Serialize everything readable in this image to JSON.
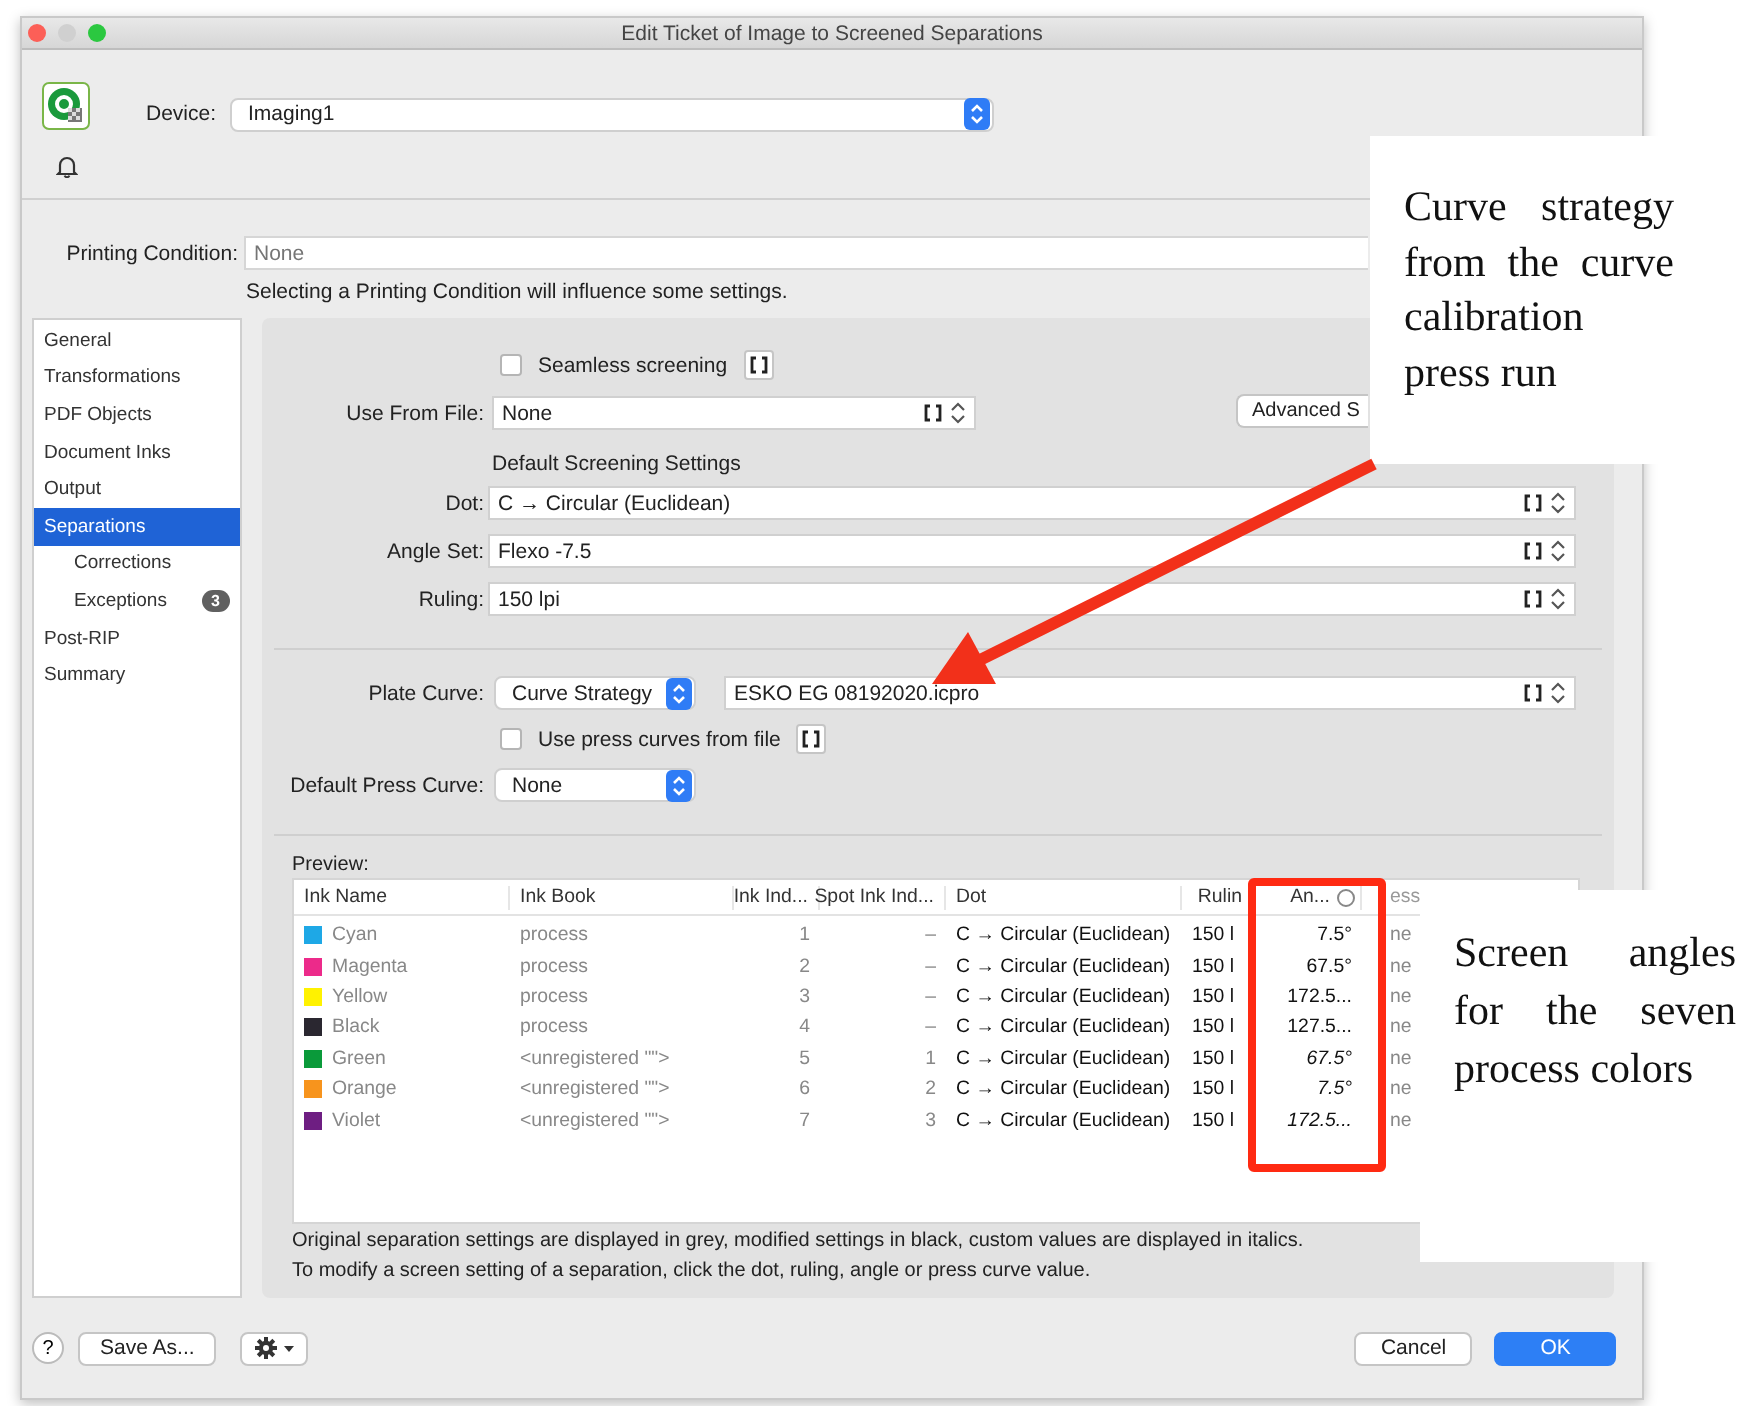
{
  "window": {
    "title": "Edit Ticket of Image to Screened Separations"
  },
  "device": {
    "label": "Device:",
    "value": "Imaging1"
  },
  "printing_condition": {
    "label": "Printing Condition:",
    "placeholder": "None",
    "note": "Selecting a Printing Condition will influence some settings."
  },
  "sidebar": {
    "items": [
      {
        "label": "General",
        "selected": false
      },
      {
        "label": "Transformations",
        "selected": false
      },
      {
        "label": "PDF Objects",
        "selected": false
      },
      {
        "label": "Document Inks",
        "selected": false
      },
      {
        "label": "Output",
        "selected": false
      },
      {
        "label": "Separations",
        "selected": true,
        "children": [
          {
            "label": "Corrections",
            "selected": false
          },
          {
            "label": "Exceptions",
            "selected": false,
            "badge": "3"
          }
        ]
      },
      {
        "label": "Post-RIP",
        "selected": false
      },
      {
        "label": "Summary",
        "selected": false
      }
    ]
  },
  "screening": {
    "seamless": {
      "label": "Seamless screening",
      "checked": false
    },
    "use_from_file": {
      "label": "Use From File:",
      "value": "None"
    },
    "advanced_button": "Advanced S",
    "section_title": "Default Screening Settings",
    "fields": [
      {
        "label": "Dot:",
        "value": "C → Circular (Euclidean)"
      },
      {
        "label": "Angle Set:",
        "value": "Flexo -7.5"
      },
      {
        "label": "Ruling:",
        "value": "150 lpi"
      }
    ]
  },
  "plate_curve": {
    "label": "Plate Curve:",
    "mode": "Curve Strategy",
    "file": "ESKO EG 08192020.icpro"
  },
  "use_press_curves": {
    "label": "Use press curves from file",
    "checked": false
  },
  "default_press_curve": {
    "label": "Default Press Curve:",
    "value": "None"
  },
  "preview": {
    "label": "Preview:",
    "columns": [
      "Ink Name",
      "Ink Book",
      "Ink Ind...",
      "Spot Ink Ind...",
      "Dot",
      "Rulin",
      "An...",
      "ess"
    ],
    "rows": [
      {
        "ink_name": "Cyan",
        "color": "#1ea8e6",
        "ink_book": "process",
        "ink_index": "1",
        "spot_ink_index": "–",
        "dot": "C → Circular (Euclidean)",
        "ruling": "150 l",
        "angle": "7.5°",
        "custom": false,
        "press_curve": "ne"
      },
      {
        "ink_name": "Magenta",
        "color": "#ec2a8a",
        "ink_book": "process",
        "ink_index": "2",
        "spot_ink_index": "–",
        "dot": "C → Circular (Euclidean)",
        "ruling": "150 l",
        "angle": "67.5°",
        "custom": false,
        "press_curve": "ne"
      },
      {
        "ink_name": "Yellow",
        "color": "#fff200",
        "ink_book": "process",
        "ink_index": "3",
        "spot_ink_index": "–",
        "dot": "C → Circular (Euclidean)",
        "ruling": "150 l",
        "angle": "172.5...",
        "custom": false,
        "press_curve": "ne"
      },
      {
        "ink_name": "Black",
        "color": "#2a2730",
        "ink_book": "process",
        "ink_index": "4",
        "spot_ink_index": "–",
        "dot": "C → Circular (Euclidean)",
        "ruling": "150 l",
        "angle": "127.5...",
        "custom": false,
        "press_curve": "ne"
      },
      {
        "ink_name": "Green",
        "color": "#0a9a3a",
        "ink_book": "<unregistered \"\">",
        "ink_index": "5",
        "spot_ink_index": "1",
        "dot": "C → Circular (Euclidean)",
        "ruling": "150 l",
        "angle": "67.5°",
        "custom": true,
        "press_curve": "ne"
      },
      {
        "ink_name": "Orange",
        "color": "#f7941d",
        "ink_book": "<unregistered \"\">",
        "ink_index": "6",
        "spot_ink_index": "2",
        "dot": "C → Circular (Euclidean)",
        "ruling": "150 l",
        "angle": "7.5°",
        "custom": true,
        "press_curve": "ne"
      },
      {
        "ink_name": "Violet",
        "color": "#6e1e82",
        "ink_book": "<unregistered \"\">",
        "ink_index": "7",
        "spot_ink_index": "3",
        "dot": "C → Circular (Euclidean)",
        "ruling": "150 l",
        "angle": "172.5...",
        "custom": true,
        "press_curve": "ne"
      }
    ]
  },
  "notes": [
    "Original separation settings are displayed in grey, modified settings in black, custom values are displayed  in italics.",
    "To modify a screen setting of a separation, click the dot, ruling, angle or press curve value."
  ],
  "footer": {
    "help_button": "?",
    "save_as_button": "Save As...",
    "cancel_button": "Cancel",
    "ok_button": "OK"
  },
  "annotations": [
    {
      "text": "Curve strategy from the curve calibration press run"
    },
    {
      "text": "Screen angles for the seven process colors"
    }
  ]
}
